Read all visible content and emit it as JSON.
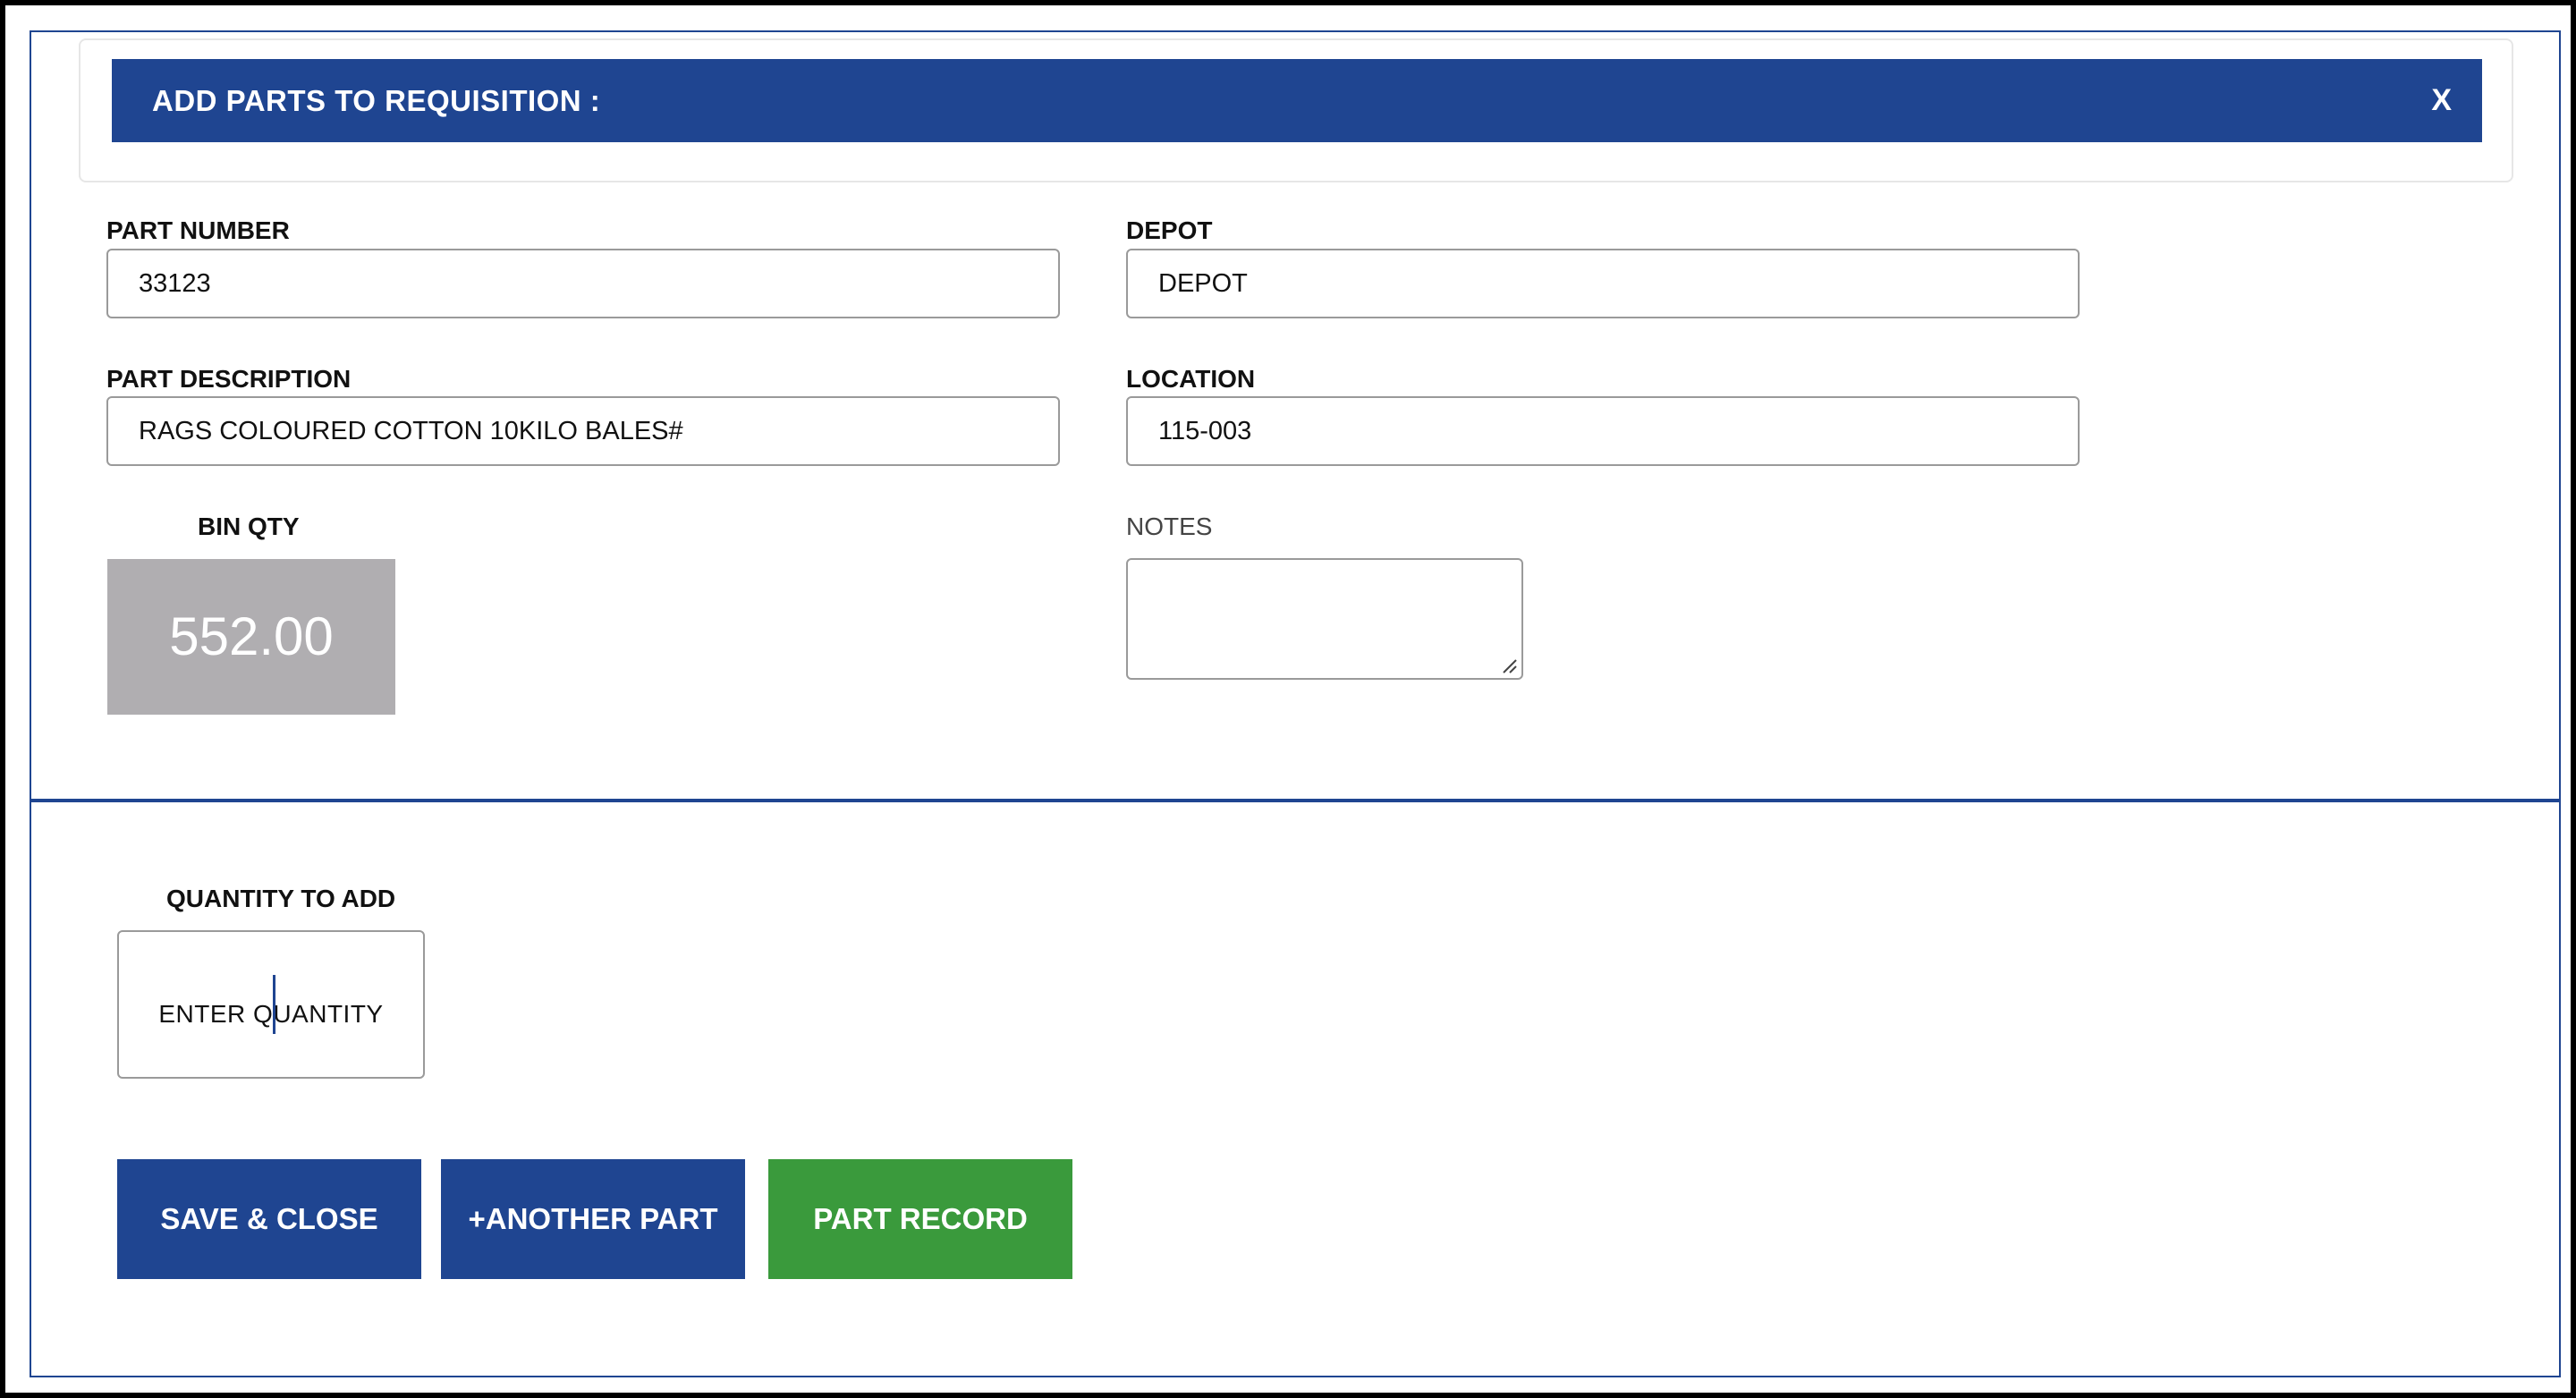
{
  "dialog": {
    "title": "ADD PARTS TO REQUISITION :",
    "close_label": "X"
  },
  "fields": {
    "part_number": {
      "label": "PART NUMBER",
      "value": "33123"
    },
    "depot": {
      "label": "DEPOT",
      "value": "DEPOT"
    },
    "part_description": {
      "label": "PART DESCRIPTION",
      "value": "RAGS COLOURED COTTON 10KILO BALES#"
    },
    "location": {
      "label": "LOCATION",
      "value": "115-003"
    },
    "bin_qty": {
      "label": "BIN QTY",
      "value": "552.00"
    },
    "notes": {
      "label": "NOTES",
      "value": ""
    }
  },
  "quantity": {
    "label": "QUANTITY TO ADD",
    "placeholder": "ENTER QUANTITY"
  },
  "buttons": {
    "save_close": "SAVE & CLOSE",
    "another_part": "+ANOTHER PART",
    "part_record": "PART RECORD"
  },
  "colors": {
    "primary": "#1f4591",
    "success": "#3a9a3c",
    "bin_box": "#b0aeb1"
  }
}
